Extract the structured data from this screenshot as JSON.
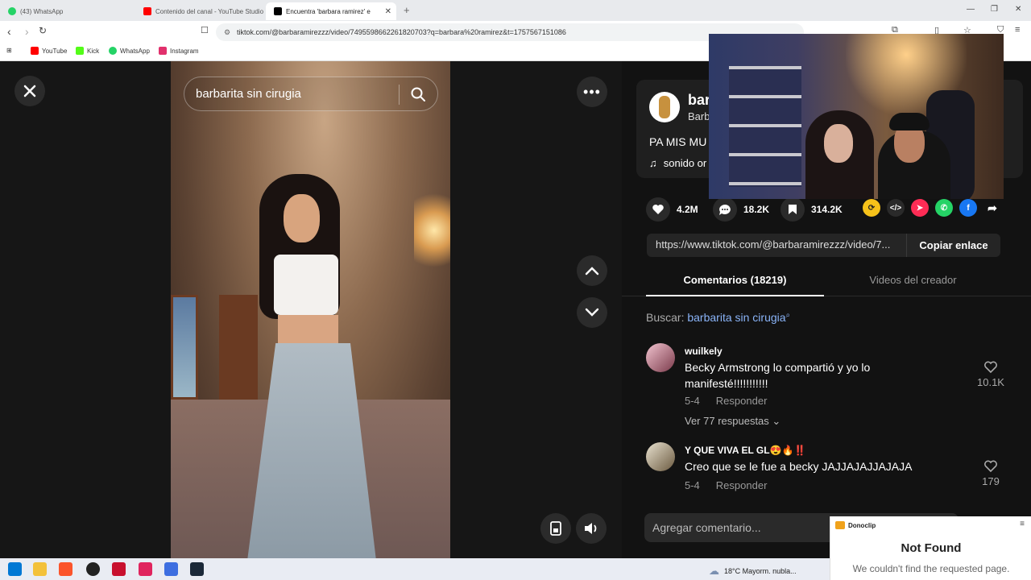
{
  "browser": {
    "tabs": [
      {
        "title": "(43) WhatsApp",
        "color": "#25d366"
      },
      {
        "title": "Contenido del canal - YouTube Studio",
        "color": "#ff0000"
      },
      {
        "title": "Encuentra 'barbara ramirez' e",
        "color": "#000000"
      }
    ],
    "url": "tiktok.com/@barbaramirezzz/video/7495598662261820703?q=barbara%20ramirez&t=1757567151086",
    "bookmarks": [
      {
        "label": "YouTube",
        "color": "#ff0000"
      },
      {
        "label": "Kick",
        "color": "#1b1b1b"
      },
      {
        "label": "WhatsApp",
        "color": "#25d366"
      },
      {
        "label": "Instagram",
        "color": "#e1306c"
      }
    ]
  },
  "video": {
    "search_query": "barbarita sin cirugia"
  },
  "author": {
    "name": "bar",
    "subtitle": "Barb"
  },
  "caption": "PA MIS MU",
  "sound": "sonido or",
  "stats": {
    "likes": "4.2M",
    "comments": "18.2K",
    "saves": "314.2K"
  },
  "link": {
    "url": "https://www.tiktok.com/@barbaramirezzz/video/7...",
    "copy_button": "Copiar enlace"
  },
  "tabs": {
    "comments": "Comentarios (18219)",
    "creator_videos": "Videos del creador"
  },
  "search_hint": {
    "prefix": "Buscar: ",
    "query": "barbarita sin cirugia"
  },
  "comments": [
    {
      "user": "wuilkely",
      "text": "Becky Armstrong lo compartió y yo lo manifesté!!!!!!!!!!!",
      "date": "5-4",
      "reply_label": "Responder",
      "likes": "10.1K",
      "replies": "Ver 77 respuestas"
    },
    {
      "user": "Y QUE VIVA EL GL😍🔥‼️",
      "text": "Creo que se le fue a becky JAJJAJAJJAJAJA",
      "date": "5-4",
      "reply_label": "Responder",
      "likes": "179"
    }
  ],
  "add_comment_placeholder": "Agregar comentario...",
  "taskbar": {
    "weather": "18°C  Mayorm. nubla..."
  },
  "notification": {
    "app": "Donoclip",
    "title": "Not Found",
    "message": "We couldn't find the requested page."
  }
}
